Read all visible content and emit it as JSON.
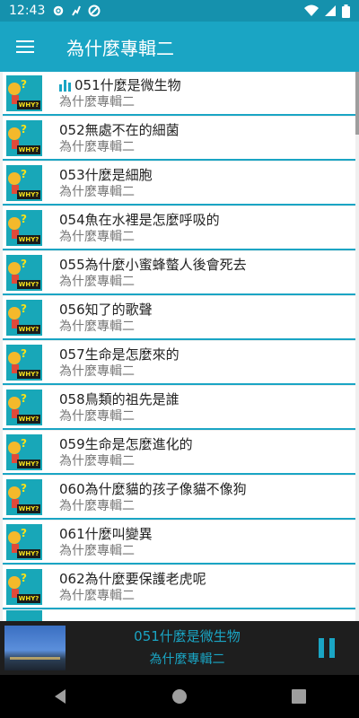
{
  "status": {
    "time": "12:43"
  },
  "appbar": {
    "title": "為什麼專輯二"
  },
  "tracks": [
    {
      "title": "051什麼是微生物",
      "album": "為什麼專輯二",
      "playing": true
    },
    {
      "title": "052無處不在的細菌",
      "album": "為什麼專輯二"
    },
    {
      "title": "053什麼是細胞",
      "album": "為什麼專輯二"
    },
    {
      "title": "054魚在水裡是怎麼呼吸的",
      "album": "為什麼專輯二"
    },
    {
      "title": "055為什麼小蜜蜂螫人後會死去",
      "album": "為什麼專輯二"
    },
    {
      "title": "056知了的歌聲",
      "album": "為什麼專輯二"
    },
    {
      "title": "057生命是怎麼來的",
      "album": "為什麼專輯二"
    },
    {
      "title": "058鳥類的祖先是誰",
      "album": "為什麼專輯二"
    },
    {
      "title": "059生命是怎麼進化的",
      "album": "為什麼專輯二"
    },
    {
      "title": "060為什麼貓的孩子像貓不像狗",
      "album": "為什麼專輯二"
    },
    {
      "title": "061什麼叫變異",
      "album": "為什麼專輯二"
    },
    {
      "title": "062為什麼要保護老虎呢",
      "album": "為什麼專輯二"
    }
  ],
  "thumb": {
    "question_mark": "?",
    "badge": "WHY?"
  },
  "player": {
    "title": "051什麼是微生物",
    "album": "為什麼專輯二"
  },
  "colors": {
    "accent": "#1aa5c4",
    "statusbar": "#1591ad",
    "player_bg": "#1e1e1e"
  }
}
